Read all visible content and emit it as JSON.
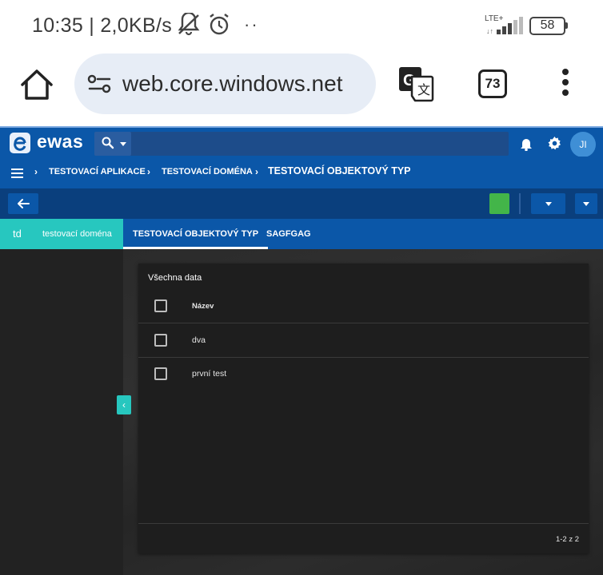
{
  "status_bar": {
    "time": "10:35 | 2,0KB/s",
    "dots": "··",
    "network": "LTE+",
    "battery": "58"
  },
  "browser": {
    "url": "web.core.windows.net",
    "tab_count": "73"
  },
  "app": {
    "logo": "ewas",
    "user_initials": "JI",
    "breadcrumb": [
      "TESTOVACÍ APLIKACE",
      "TESTOVACÍ DOMÉNA",
      "TESTOVACÍ OBJEKTOVÝ TYP"
    ],
    "tabs": {
      "domain_abbr": "td",
      "domain_label": "testovací doména",
      "items": [
        "TESTOVACÍ OBJEKTOVÝ TYP",
        "SAGFGAG"
      ]
    },
    "colors": {
      "header_blue": "#0b57a8",
      "action_blue": "#0a3f7d",
      "teal": "#27c7bf",
      "green": "#43b549"
    }
  },
  "table": {
    "title": "Všechna data",
    "columns": [
      "Název"
    ],
    "rows": [
      "dva",
      "první test"
    ],
    "pagination": "1-2 z 2"
  }
}
